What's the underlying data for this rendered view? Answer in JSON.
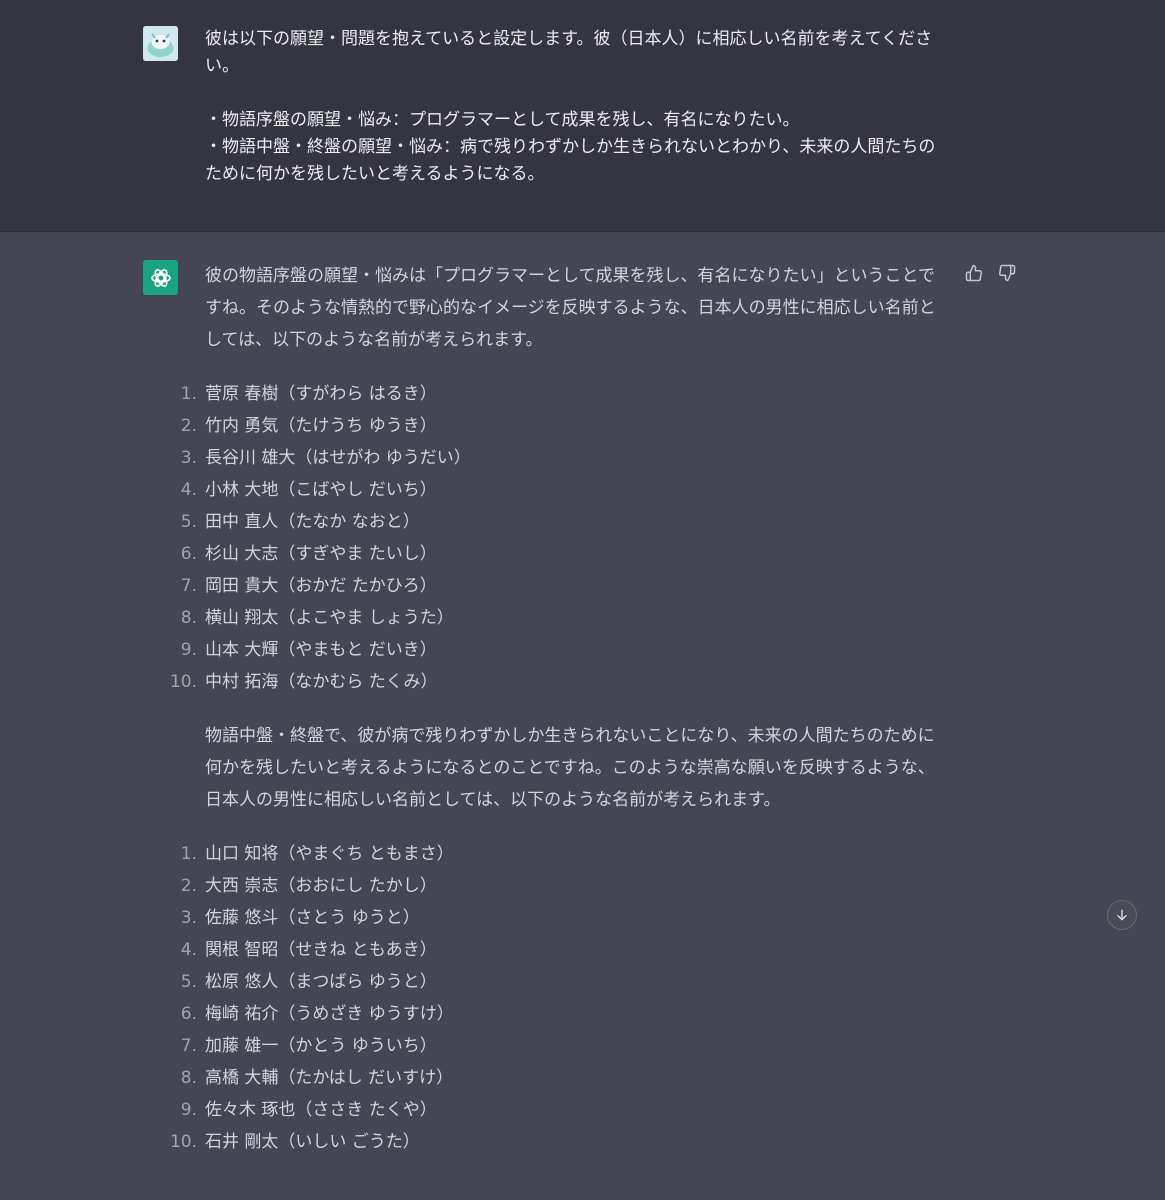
{
  "user_message": {
    "text": "彼は以下の願望・問題を抱えていると設定します。彼（日本人）に相応しい名前を考えてください。\n\n・物語序盤の願望・悩み：プログラマーとして成果を残し、有名になりたい。\n・物語中盤・終盤の願望・悩み：病で残りわずかしか生きられないとわかり、未来の人間たちのために何かを残したいと考えるようになる。"
  },
  "assistant_message": {
    "intro1": "彼の物語序盤の願望・悩みは「プログラマーとして成果を残し、有名になりたい」ということですね。そのような情熱的で野心的なイメージを反映するような、日本人の男性に相応しい名前としては、以下のような名前が考えられます。",
    "list1": [
      {
        "num": "1.",
        "name": "菅原 春樹（すがわら はるき）"
      },
      {
        "num": "2.",
        "name": "竹内 勇気（たけうち ゆうき）"
      },
      {
        "num": "3.",
        "name": "長谷川 雄大（はせがわ ゆうだい）"
      },
      {
        "num": "4.",
        "name": "小林 大地（こばやし だいち）"
      },
      {
        "num": "5.",
        "name": "田中 直人（たなか なおと）"
      },
      {
        "num": "6.",
        "name": "杉山 大志（すぎやま たいし）"
      },
      {
        "num": "7.",
        "name": "岡田 貴大（おかだ たかひろ）"
      },
      {
        "num": "8.",
        "name": "横山 翔太（よこやま しょうた）"
      },
      {
        "num": "9.",
        "name": "山本 大輝（やまもと だいき）"
      },
      {
        "num": "10.",
        "name": "中村 拓海（なかむら たくみ）"
      }
    ],
    "intro2": "物語中盤・終盤で、彼が病で残りわずかしか生きられないことになり、未来の人間たちのために何かを残したいと考えるようになるとのことですね。このような崇高な願いを反映するような、日本人の男性に相応しい名前としては、以下のような名前が考えられます。",
    "list2": [
      {
        "num": "1.",
        "name": "山口 知将（やまぐち ともまさ）"
      },
      {
        "num": "2.",
        "name": "大西 崇志（おおにし たかし）"
      },
      {
        "num": "3.",
        "name": "佐藤 悠斗（さとう ゆうと）"
      },
      {
        "num": "4.",
        "name": "関根 智昭（せきね ともあき）"
      },
      {
        "num": "5.",
        "name": "松原 悠人（まつばら ゆうと）"
      },
      {
        "num": "6.",
        "name": "梅崎 祐介（うめざき ゆうすけ）"
      },
      {
        "num": "7.",
        "name": "加藤 雄一（かとう ゆういち）"
      },
      {
        "num": "8.",
        "name": "高橋 大輔（たかはし だいすけ）"
      },
      {
        "num": "9.",
        "name": "佐々木 琢也（ささき たくや）"
      },
      {
        "num": "10.",
        "name": "石井 剛太（いしい ごうた）"
      }
    ]
  },
  "icons": {
    "user_avatar": "user-avatar-icon",
    "assistant_avatar": "openai-logo-icon",
    "thumbs_up": "thumbs-up-icon",
    "thumbs_down": "thumbs-down-icon",
    "scroll_down": "arrow-down-icon"
  },
  "colors": {
    "user_bg": "#343541",
    "assistant_bg": "#444654",
    "assistant_avatar_bg": "#19a37f",
    "text": "#d1d5db"
  }
}
